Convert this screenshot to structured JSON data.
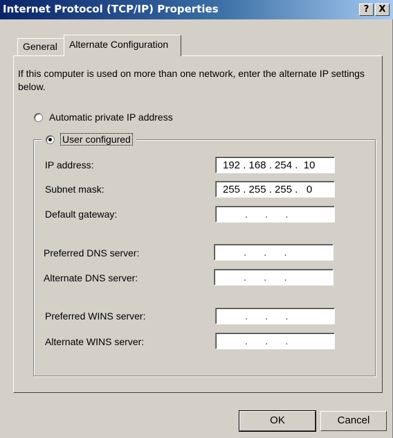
{
  "window": {
    "title": "Internet Protocol (TCP/IP) Properties",
    "help_button": "?",
    "close_button": "X"
  },
  "tabs": [
    {
      "label": "General"
    },
    {
      "label": "Alternate Configuration",
      "selected": true
    }
  ],
  "description": "If this computer is used on more than one network, enter the alternate IP settings below.",
  "options": {
    "automatic": {
      "label": "Automatic private IP address",
      "checked": false
    },
    "user_configured": {
      "label": "User configured",
      "checked": true
    }
  },
  "fields": {
    "ip_address": {
      "label": "IP address:",
      "value": "192 . 168 . 254 .  10"
    },
    "subnet_mask": {
      "label": "Subnet mask:",
      "value": "255 . 255 . 255 .   0"
    },
    "default_gateway": {
      "label": "Default gateway:",
      "value": ".      .      ."
    },
    "preferred_dns": {
      "label": "Preferred DNS server:",
      "value": ".      .      ."
    },
    "alternate_dns": {
      "label": "Alternate DNS server:",
      "value": ".      .      ."
    },
    "preferred_wins": {
      "label": "Preferred WINS server:",
      "value": ".      .      ."
    },
    "alternate_wins": {
      "label": "Alternate WINS server:",
      "value": ".      .      ."
    }
  },
  "buttons": {
    "ok": "OK",
    "cancel": "Cancel"
  }
}
